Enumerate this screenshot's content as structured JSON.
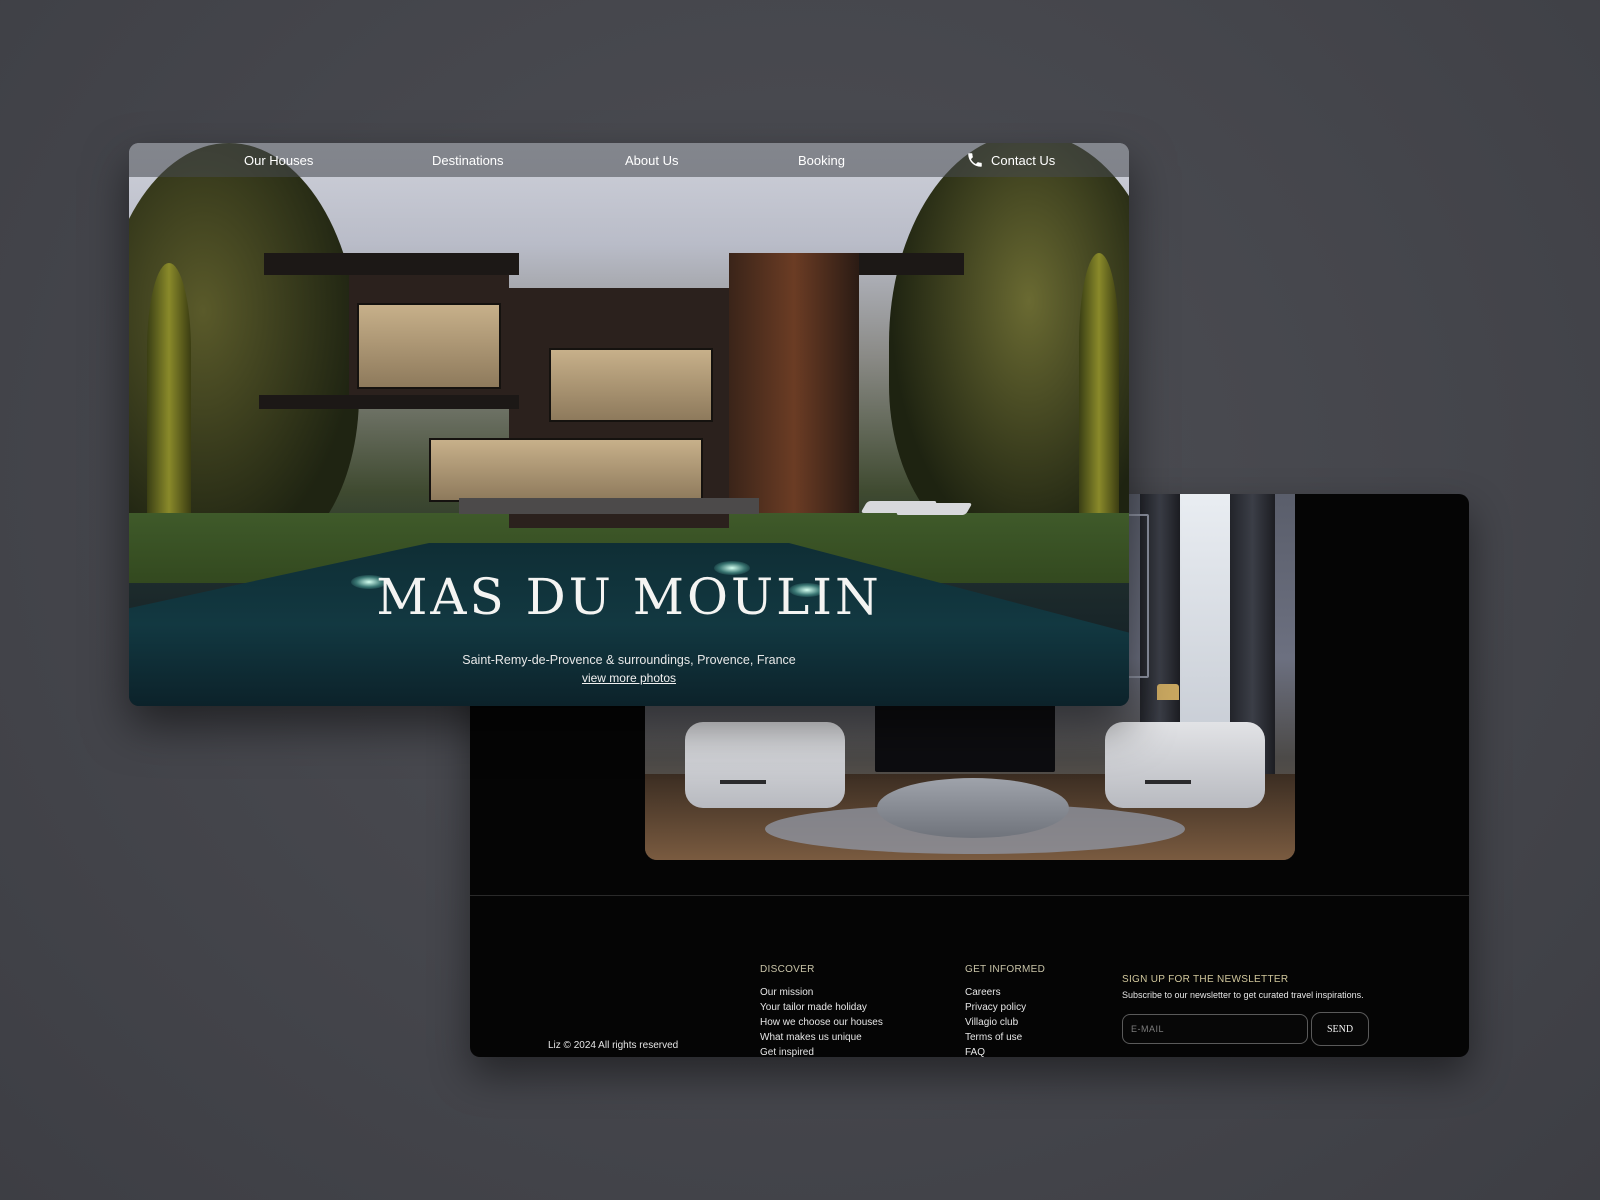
{
  "nav": {
    "items": [
      {
        "label": "Our Houses"
      },
      {
        "label": "Destinations"
      },
      {
        "label": "About Us"
      },
      {
        "label": "Booking"
      }
    ],
    "contact": {
      "label": "Contact Us",
      "icon": "phone-icon"
    }
  },
  "hero": {
    "title": "MAS DU MOULIN",
    "subtitle": "Saint-Remy-de-Provence & surroundings, Provence, France",
    "link": "view more photos"
  },
  "gallery": {
    "next_icon": "chevron-right-icon",
    "next_glyph": "›"
  },
  "footer": {
    "discover": {
      "heading": "DISCOVER",
      "links": [
        "Our mission",
        "Your tailor made holiday",
        "How we choose our houses",
        "What makes us unique",
        "Get inspired"
      ]
    },
    "informed": {
      "heading": "GET INFORMED",
      "links": [
        "Careers",
        "Privacy policy",
        "Villagio club",
        "Terms of use",
        "FAQ"
      ]
    },
    "copyright": "Liz © 2024 All rights reserved",
    "newsletter": {
      "heading": "SIGN UP FOR THE NEWSLETTER",
      "subtext": "Subscribe to our newsletter to get curated travel inspirations.",
      "placeholder": "E-MAIL",
      "button": "SEND"
    }
  },
  "colors": {
    "background": "#46474d",
    "footer_bg": "#050505",
    "accent_gold": "#d1c79c",
    "text_light": "#ffffff"
  }
}
